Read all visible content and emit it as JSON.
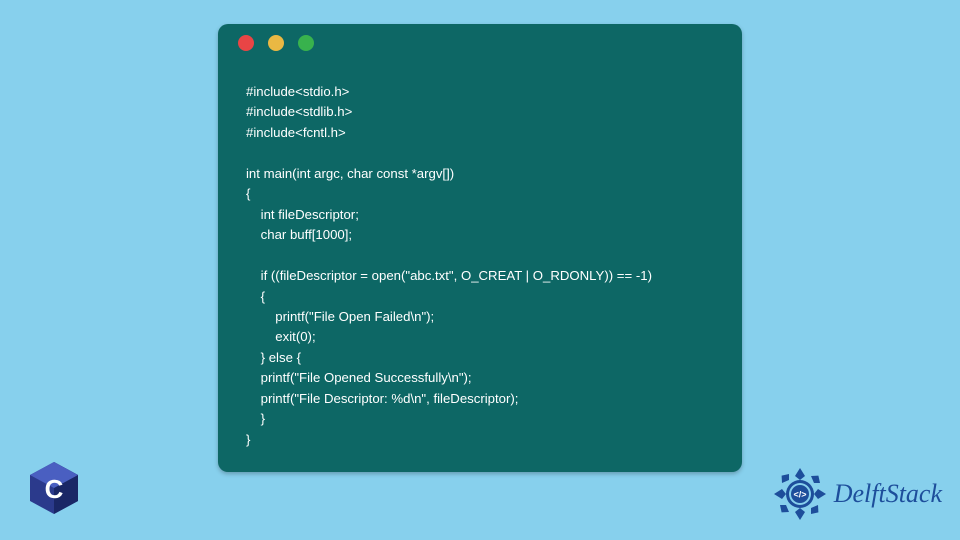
{
  "window": {
    "dots": [
      "close",
      "minimize",
      "maximize"
    ]
  },
  "code": {
    "lines": [
      "#include<stdio.h>",
      "#include<stdlib.h>",
      "#include<fcntl.h>",
      "",
      "int main(int argc, char const *argv[])",
      "{",
      "    int fileDescriptor;",
      "    char buff[1000];",
      "",
      "    if ((fileDescriptor = open(\"abc.txt\", O_CREAT | O_RDONLY)) == -1)",
      "    {",
      "        printf(\"File Open Failed\\n\");",
      "        exit(0);",
      "    } else {",
      "    printf(\"File Opened Successfully\\n\");",
      "    printf(\"File Descriptor: %d\\n\", fileDescriptor);",
      "    }",
      "}"
    ]
  },
  "logo_c": {
    "letter": "C"
  },
  "brand": {
    "name": "DelftStack",
    "badge_glyph": "</>"
  }
}
